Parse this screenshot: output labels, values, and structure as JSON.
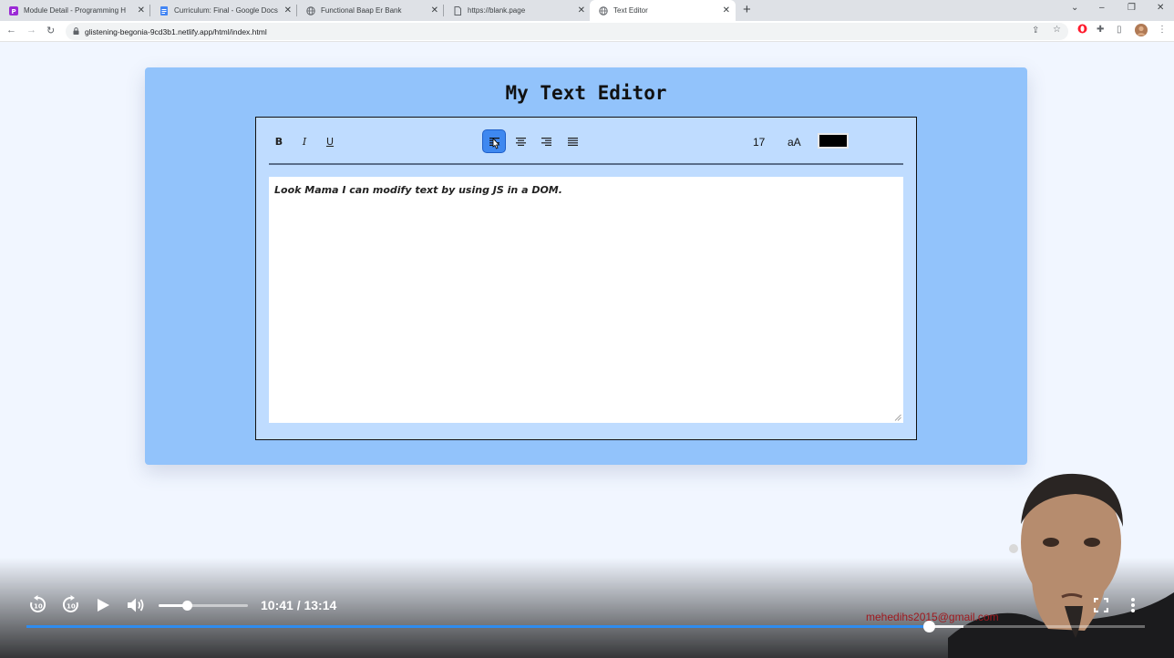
{
  "browser": {
    "tabs": [
      {
        "title": "Module Detail - Programming H",
        "icon": "programming-hero-icon",
        "color": "#9b2ad6"
      },
      {
        "title": "Curriculum: Final - Google Docs",
        "icon": "google-docs-icon",
        "color": "#4285f4"
      },
      {
        "title": "Functional Baap Er Bank",
        "icon": "globe-icon",
        "color": "#5f6368"
      },
      {
        "title": "https://blank.page",
        "icon": "page-icon",
        "color": "#5f6368"
      },
      {
        "title": "Text Editor",
        "icon": "globe-icon",
        "color": "#5f6368"
      }
    ],
    "active_tab": 4,
    "url": "glistening-begonia-9cd3b1.netlify.app/html/index.html"
  },
  "page": {
    "heading": "My Text Editor",
    "toolbar": {
      "bold_label": "B",
      "italic_label": "I",
      "underline_label": "U",
      "align_buttons": [
        "align-left-button",
        "align-center-button",
        "align-right-button",
        "align-justify-button"
      ],
      "active_align": "align-left-button",
      "font_size": "17",
      "case_label": "aA",
      "text_color": "#000000"
    },
    "editor_text": "Look Mama I can modify text by using JS in a DOM."
  },
  "video": {
    "time": "10:41 / 13:14",
    "progress": 0.8076,
    "buffered": 0.838,
    "volume": 0.32,
    "watermark": "mehedihs2015@gmail.com"
  },
  "colors": {
    "card_bg": "#92c3fb",
    "editor_bg": "#bfdcff",
    "active_button": "#3e88f0",
    "progress": "#2e8cf0"
  }
}
